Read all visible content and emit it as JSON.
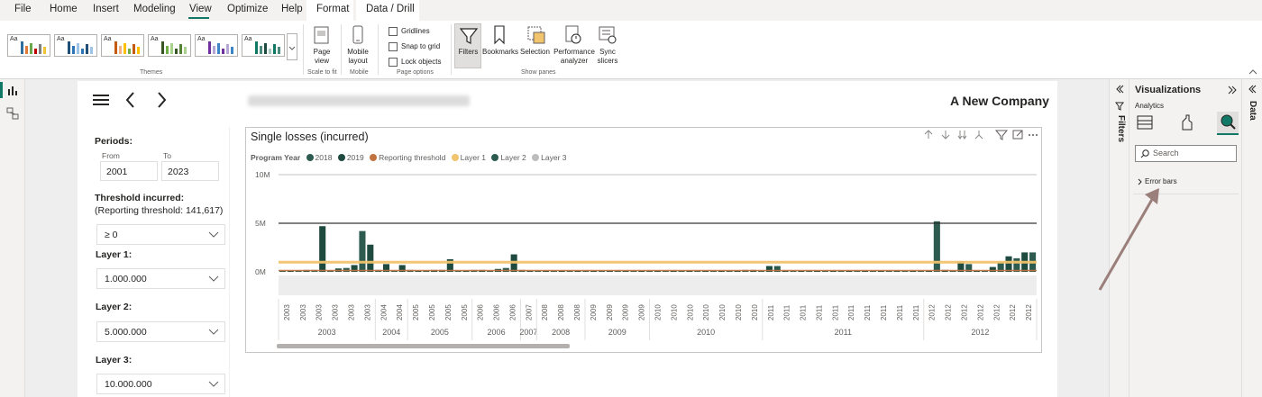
{
  "menu": {
    "items": [
      "File",
      "Home",
      "Insert",
      "Modeling",
      "View",
      "Optimize",
      "Help"
    ],
    "active": "View",
    "contextual_tabs": [
      "Format",
      "Data / Drill"
    ]
  },
  "ribbon": {
    "themes_label": "Themes",
    "theme_thumb_text": "Aa",
    "page_view": "Page view",
    "scale_to_fit": "Scale to fit",
    "mobile_layout": "Mobile layout",
    "mobile": "Mobile",
    "gridlines": "Gridlines",
    "snap_to_grid": "Snap to grid",
    "lock_objects": "Lock objects",
    "page_options": "Page options",
    "filters": "Filters",
    "bookmarks": "Bookmarks",
    "selection": "Selection",
    "performance_analyzer": "Performance analyzer",
    "sync_slicers": "Sync slicers",
    "show_panes": "Show panes"
  },
  "report": {
    "company": "A New Company",
    "periods_label": "Periods:",
    "from_label": "From",
    "to_label": "To",
    "from_value": "2001",
    "to_value": "2023",
    "threshold_label": "Threshold incurred:",
    "threshold_note": "(Reporting threshold: 141,617)",
    "threshold_value": "≥ 0",
    "layer1_label": "Layer 1:",
    "layer1_value": "1.000.000",
    "layer2_label": "Layer 2:",
    "layer2_value": "5.000.000",
    "layer3_label": "Layer 3:",
    "layer3_value": "10.000.000"
  },
  "colors": {
    "bar_2018": "#2e5b50",
    "bar_2019": "#1f4a40",
    "layer1": "#f2c46d",
    "threshold": "#c0733f",
    "layer2": "#2b2b2b",
    "layer3": "#bdbdbd",
    "accent": "#117865"
  },
  "panes": {
    "visualizations": "Visualizations",
    "analytics": "Analytics",
    "search_placeholder": "Search",
    "error_bars": "Error bars",
    "filters": "Filters",
    "data": "Data"
  },
  "chart_data": {
    "type": "bar",
    "title": "Single losses (incurred)",
    "legend_title": "Program Year",
    "series": [
      {
        "name": "2018"
      },
      {
        "name": "2019"
      },
      {
        "name": "Reporting threshold",
        "value": 141617
      },
      {
        "name": "Layer 1",
        "value": 1000000
      },
      {
        "name": "Layer 2",
        "value": 5000000
      },
      {
        "name": "Layer 3",
        "value": 10000000
      }
    ],
    "y_ticks": [
      "0M",
      "5M",
      "10M"
    ],
    "ylim": [
      0,
      10000000
    ],
    "year_groups": [
      {
        "year": "2003",
        "count": 6
      },
      {
        "year": "2004",
        "count": 2
      },
      {
        "year": "2005",
        "count": 4
      },
      {
        "year": "2006",
        "count": 3
      },
      {
        "year": "2007",
        "count": 1
      },
      {
        "year": "2008",
        "count": 3
      },
      {
        "year": "2009",
        "count": 4
      },
      {
        "year": "2010",
        "count": 7
      },
      {
        "year": "2011",
        "count": 10
      },
      {
        "year": "2012",
        "count": 7
      }
    ],
    "bars_millions": [
      0.1,
      0.1,
      0.15,
      0.2,
      0.2,
      4.7,
      0.15,
      0.35,
      0.4,
      0.7,
      4.2,
      2.8,
      0.2,
      0.8,
      0.1,
      0.7,
      0.2,
      0.1,
      0.15,
      0.2,
      0.2,
      1.3,
      0.1,
      0.1,
      0.2,
      0.2,
      0.1,
      0.3,
      0.4,
      1.8,
      0.2,
      0.1,
      0.1,
      0.1,
      0.1,
      0.1,
      0.1,
      0.1,
      0.1,
      0.1,
      0.1,
      0.1,
      0.1,
      0.1,
      0.1,
      0.1,
      0.1,
      0.1,
      0.1,
      0.1,
      0.1,
      0.1,
      0.1,
      0.1,
      0.1,
      0.1,
      0.1,
      0.1,
      0.2,
      0.2,
      0.1,
      0.6,
      0.6,
      0.1,
      0.1,
      0.1,
      0.1,
      0.1,
      0.1,
      0.1,
      0.1,
      0.1,
      0.1,
      0.1,
      0.1,
      0.1,
      0.1,
      0.1,
      0.1,
      0.1,
      0.1,
      0.1,
      5.2,
      0.2,
      0.1,
      1.1,
      0.8,
      0.1,
      0.1,
      0.5,
      1.0,
      1.6,
      1.4,
      2.0,
      2.0
    ],
    "grid": true
  }
}
